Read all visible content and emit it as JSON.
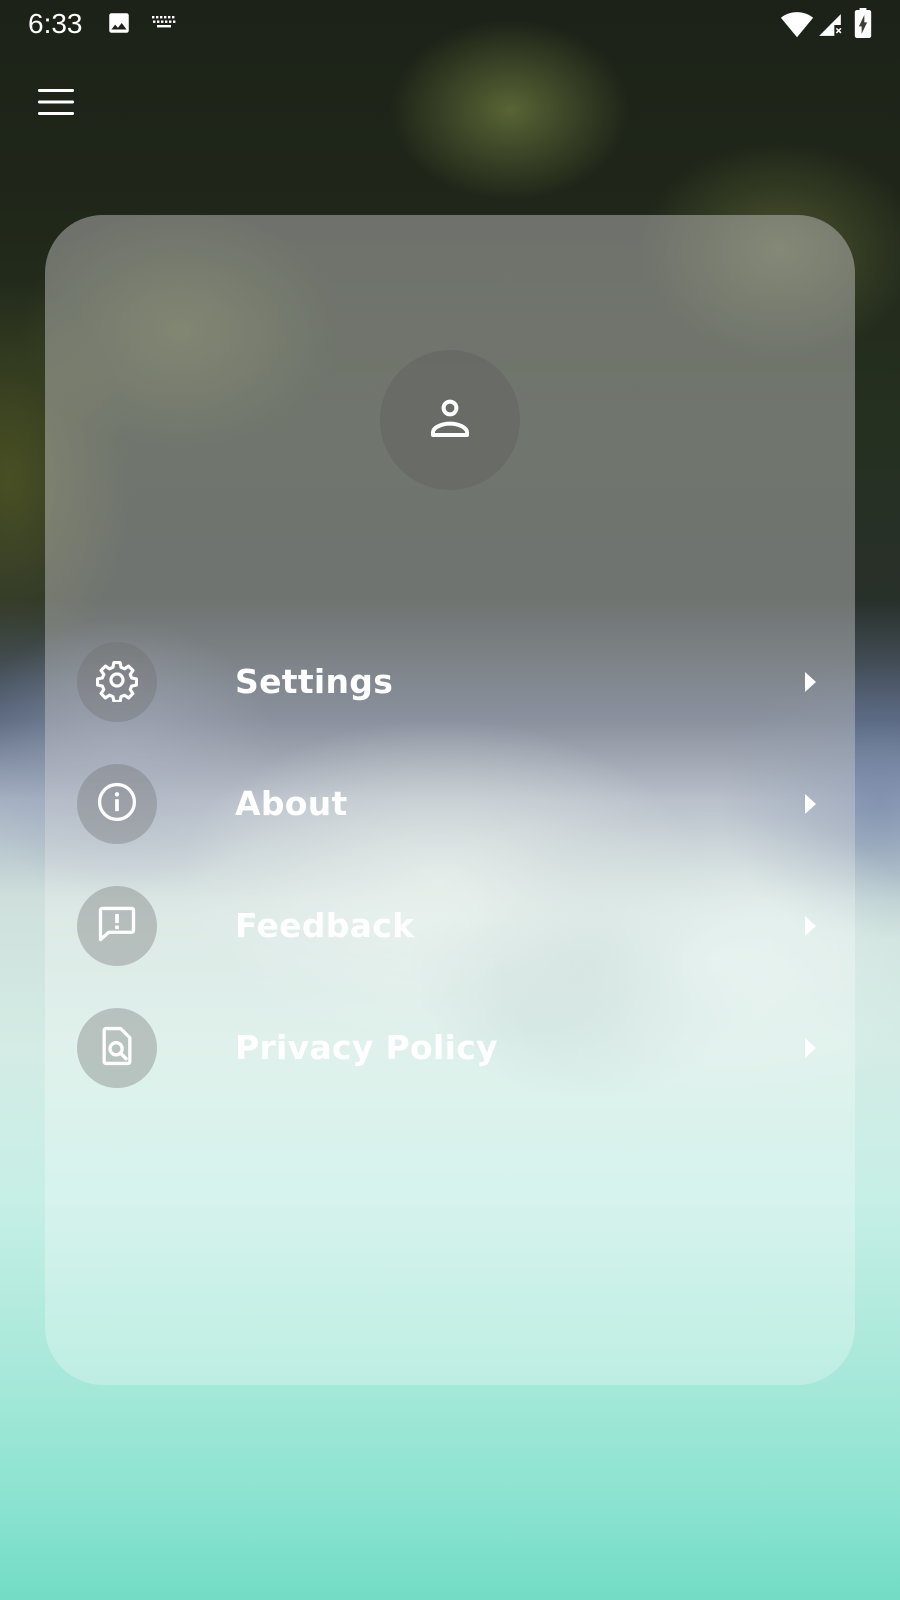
{
  "status_bar": {
    "time": "6:33",
    "icons": [
      "image-icon",
      "keyboard-icon",
      "wifi-icon",
      "cell-signal-no-data-icon",
      "battery-charging-icon"
    ]
  },
  "header": {
    "menu_icon": "hamburger-menu-icon"
  },
  "profile": {
    "avatar_icon": "person-icon"
  },
  "menu": {
    "items": [
      {
        "label": "Settings",
        "icon": "gear-icon"
      },
      {
        "label": "About",
        "icon": "info-icon"
      },
      {
        "label": "Feedback",
        "icon": "feedback-icon"
      },
      {
        "label": "Privacy Policy",
        "icon": "document-search-icon"
      }
    ],
    "chevron_icon": "chevron-right-icon"
  },
  "colors": {
    "text": "#ffffff",
    "card_overlay": "rgba(255,255,255,0.28)",
    "icon_circle": "rgba(110,110,110,0.35)"
  }
}
